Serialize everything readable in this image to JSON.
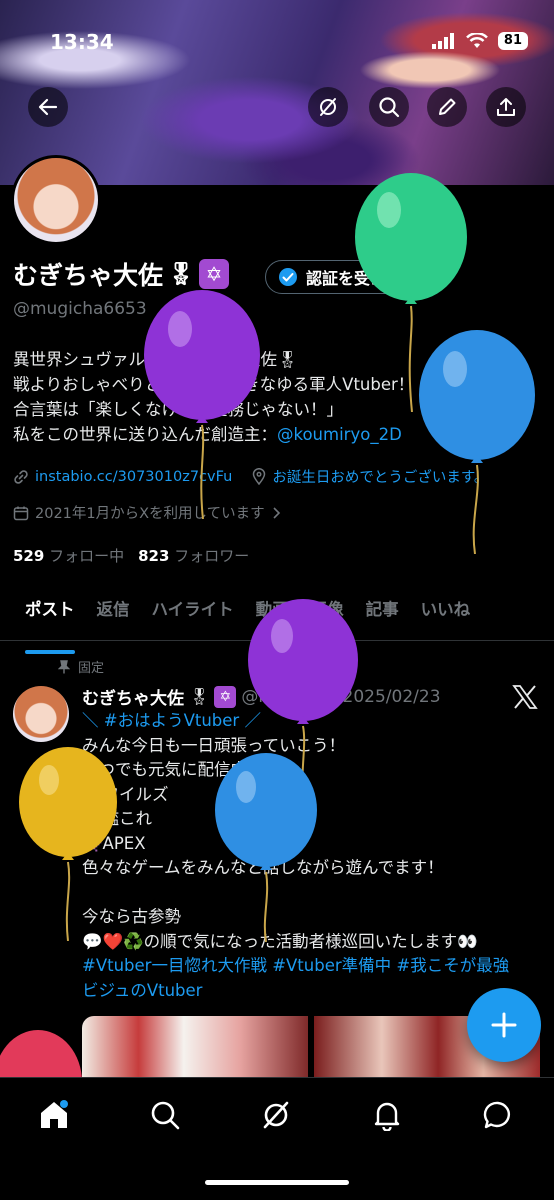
{
  "status": {
    "time": "13:34",
    "battery": "81"
  },
  "profile": {
    "name": "むぎちゃ大佐",
    "name_badges": [
      "🎖",
      "✡"
    ],
    "verify_label": "認証を受ける",
    "handle": "@mugicha6653",
    "bio_lines": [
      "異世界シュヴァルツ王国の若き大佐🎖",
      "戦よりおしゃべりとゲームが好きなゆる軍人Vtuber！",
      "合言葉は「楽しくなければ任務じゃない！」",
      "私をこの世界に送り込んだ創造主："
    ],
    "creator_handle": "@koumiryo_2D",
    "link": "instabio.cc/3073010z7cvFu",
    "birthday": "お誕生日おめでとうございます。",
    "joined": "2021年1月からXを利用しています",
    "following_count": "529",
    "following_label": "フォロー中",
    "followers_count": "823",
    "followers_label": "フォロワー"
  },
  "tabs": [
    "ポスト",
    "返信",
    "ハイライト",
    "動画",
    "画像",
    "記事",
    "いいね"
  ],
  "pinned_post": {
    "pinned_label": "固定",
    "author": "むぎちゃ大佐",
    "handle": "@mugic...",
    "date": "· 2025/02/23",
    "lines": [
      "＼ #おはようVtuber ／",
      "みんな今日も一日頑張っていこう！",
      "いつでも元気に配信中！",
      "👾ワイルズ",
      "👾艦これ",
      "👾APEX",
      "色々なゲームをみんなと話しながら遊んでます！",
      "",
      "今なら古参勢",
      "💬❤️♻️の順で気になった活動者様巡回いたします👀",
      "#Vtuber一目惚れ大作戦 #Vtuber準備中 #我こそが最強",
      "ビジュのVtuber"
    ]
  },
  "colors": {
    "accent": "#1d9bf0",
    "background": "#000000",
    "secondary_text": "#71767b",
    "balloon_green": "#2ecc8a",
    "balloon_purple": "#8e33d6",
    "balloon_blue": "#2f8fe3",
    "balloon_yellow": "#e6b51e",
    "balloon_red": "#e23a5a"
  }
}
